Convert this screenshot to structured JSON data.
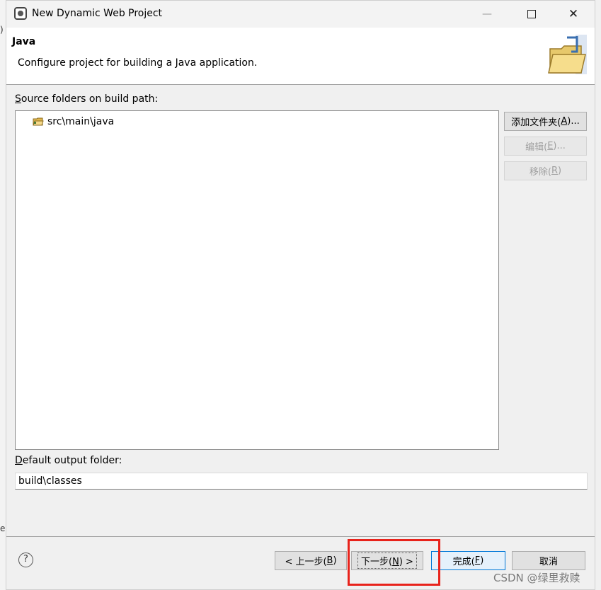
{
  "window": {
    "title": "New Dynamic Web Project",
    "controls": {
      "minimize": "—",
      "maximize": "",
      "close": "✕"
    }
  },
  "banner": {
    "title": "Java",
    "description": "Configure project for building a Java application.",
    "icon": "folder-java-icon"
  },
  "source_section": {
    "label_accel": "S",
    "label_rest": "ource folders on build path:",
    "items": [
      {
        "label": "src\\main\\java",
        "icon": "source-folder-icon"
      }
    ],
    "buttons": {
      "add_prefix": "添加文件夹(",
      "add_accel": "A",
      "add_suffix": ")...",
      "edit_prefix": "编辑(",
      "edit_accel": "E",
      "edit_suffix": ")...",
      "remove_prefix": "移除(",
      "remove_accel": "R",
      "remove_suffix": ")"
    }
  },
  "output_section": {
    "label_accel": "D",
    "label_rest": "efault output folder:",
    "value": "build\\classes"
  },
  "footer": {
    "help": "?",
    "back_prefix": "< 上一步(",
    "back_accel": "B",
    "back_suffix": ")",
    "next_prefix": "下一步(",
    "next_accel": "N",
    "next_suffix": ") >",
    "finish_prefix": "完成(",
    "finish_accel": "F",
    "finish_suffix": ")",
    "cancel": "取消"
  },
  "annotation": {
    "color": "#e8231b"
  },
  "watermark": "CSDN @绿里救赎",
  "background_fragments": {
    "top": ")",
    "bottom": "e"
  },
  "colors": {
    "accent": "#0078d7",
    "window_bg": "#f0f0f0",
    "banner_bg": "#ffffff"
  }
}
